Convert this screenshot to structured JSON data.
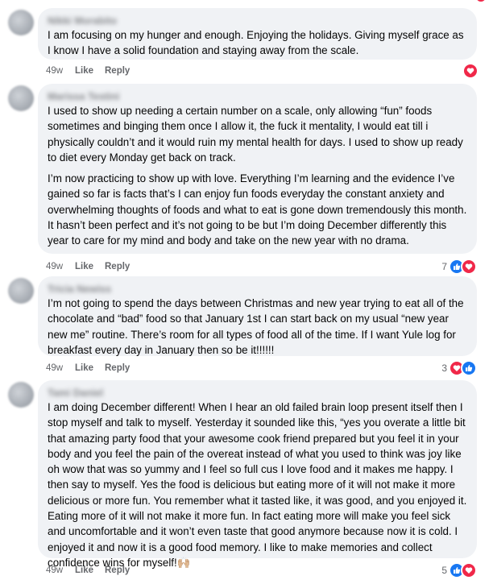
{
  "comments": [
    {
      "name": "Nikki Morabito",
      "paragraphs": [
        "I am focusing on my hunger and enough. Enjoying the holidays. Giving myself grace as I know I have a solid foundation and staying away from the scale."
      ],
      "time": "49w",
      "like": "Like",
      "reply": "Reply",
      "reaction_count": "",
      "reactions": [
        "heart-icon"
      ]
    },
    {
      "name": "Marissa Testini",
      "paragraphs": [
        "I used to show up needing a certain number on a scale, only allowing “fun” foods sometimes and binging them once I allow it, the fuck it mentality, I would eat till i physically couldn’t and it would ruin my mental health for days. I used to show up ready to diet every Monday get back on track.",
        "I’m now practicing to show up with love. Everything I’m learning and the evidence I’ve gained so far is facts that’s I can enjoy fun foods everyday the constant anxiety and overwhelming thoughts of foods and what to eat is gone down tremendously this month. It hasn’t been perfect and it’s not going to be but I’m doing December differently this year to care for my mind and body and take on the new year with no drama."
      ],
      "time": "49w",
      "like": "Like",
      "reply": "Reply",
      "reaction_count": "7",
      "reactions": [
        "like-icon",
        "heart-icon"
      ]
    },
    {
      "name": "Tricia Newiss",
      "paragraphs": [
        "I’m not going to spend the days between Christmas and new year trying to eat all of the chocolate and “bad” food so that January 1st I can start back on my usual “new year new me” routine. There’s room for all types of food all of the time. If I want Yule log for breakfast every day in January then so be it!!!!!!"
      ],
      "time": "49w",
      "like": "Like",
      "reply": "Reply",
      "reaction_count": "3",
      "reactions": [
        "heart-icon",
        "like-icon"
      ]
    },
    {
      "name": "Tami Daniel",
      "paragraphs": [
        "I am doing December different! When I hear an old failed brain loop present itself then I stop myself and talk to myself. Yesterday it sounded like this, “yes you overate a little bit that amazing party food that your awesome cook friend prepared but you feel it in your body and you feel the pain of the overeat instead of what you used to think was joy like oh wow that was so yummy and I feel so full cus I love food and it makes me happy. I then say to myself. Yes the food is delicious but eating more of it will not make it more delicious or more fun. You remember what it tasted like, it was good, and you enjoyed it. Eating more of it will not make it more fun. In fact eating more will make you feel sick and uncomfortable and it won’t even taste that good anymore because now it is cold. I enjoyed it and now it is a good food memory. I like to make memories and collect confidence wins for myself!🙌🏼"
      ],
      "time": "49w",
      "like": "Like",
      "reply": "Reply",
      "reaction_count": "5",
      "reactions": [
        "like-icon",
        "heart-icon"
      ]
    }
  ],
  "colors": {
    "bubble": "#f0f2f5",
    "like_blue": "#1877f2",
    "love_red": "#f02849",
    "meta_gray": "#65676b"
  }
}
